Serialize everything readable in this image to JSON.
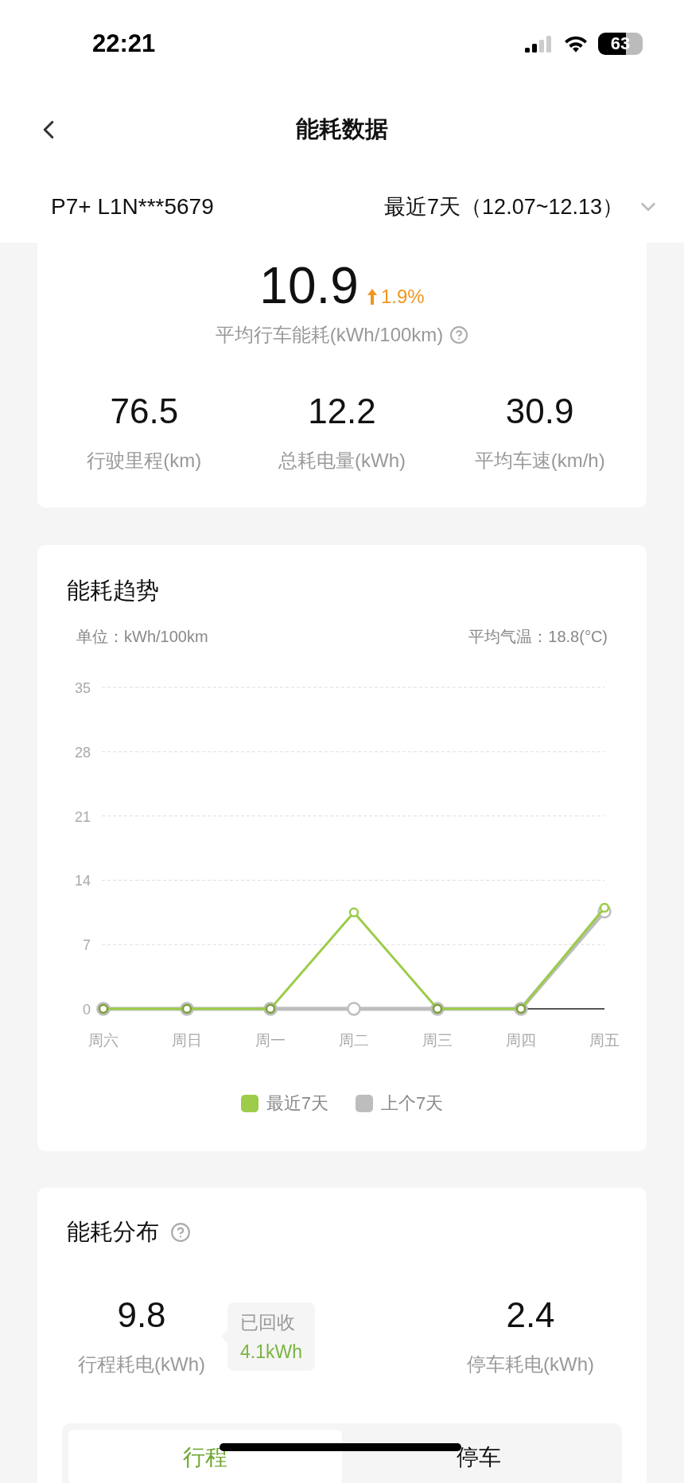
{
  "status_bar": {
    "time": "22:21",
    "battery": "63"
  },
  "nav": {
    "title": "能耗数据"
  },
  "vehicle": {
    "name": "P7+ L1N***5679",
    "period": "最近7天（12.07~12.13）"
  },
  "summary": {
    "value": "10.9",
    "change": "1.9%",
    "label": "平均行车能耗(kWh/100km)",
    "stats": [
      {
        "value": "76.5",
        "label": "行驶里程(km)"
      },
      {
        "value": "12.2",
        "label": "总耗电量(kWh)"
      },
      {
        "value": "30.9",
        "label": "平均车速(km/h)"
      }
    ]
  },
  "trend": {
    "title": "能耗趋势",
    "unit": "单位：kWh/100km",
    "temperature": "平均气温：18.8(°C)",
    "chart_data": {
      "type": "line",
      "grid": true,
      "categories": [
        "周六",
        "周日",
        "周一",
        "周二",
        "周三",
        "周四",
        "周五"
      ],
      "ylim": [
        0,
        35
      ],
      "yticks": [
        0,
        7,
        14,
        21,
        28,
        35
      ],
      "series": [
        {
          "name": "上个7天",
          "color": "#bdbdbd",
          "marker": "circle",
          "values": [
            0,
            0,
            0,
            0,
            0,
            0,
            10.6
          ]
        },
        {
          "name": "最近7天",
          "color": "#9ccc4a",
          "marker": "circle",
          "values": [
            0,
            0,
            0,
            10.5,
            0,
            0,
            11
          ]
        }
      ]
    }
  },
  "distribution": {
    "title": "能耗分布",
    "driving": {
      "value": "9.8",
      "label": "行程耗电(kWh)"
    },
    "recovered": {
      "label": "已回收",
      "value": "4.1kWh"
    },
    "parking": {
      "value": "2.4",
      "label": "停车耗电(kWh)"
    },
    "tabs": [
      {
        "label": "行程",
        "selected": true
      },
      {
        "label": "停车",
        "selected": false
      }
    ]
  }
}
